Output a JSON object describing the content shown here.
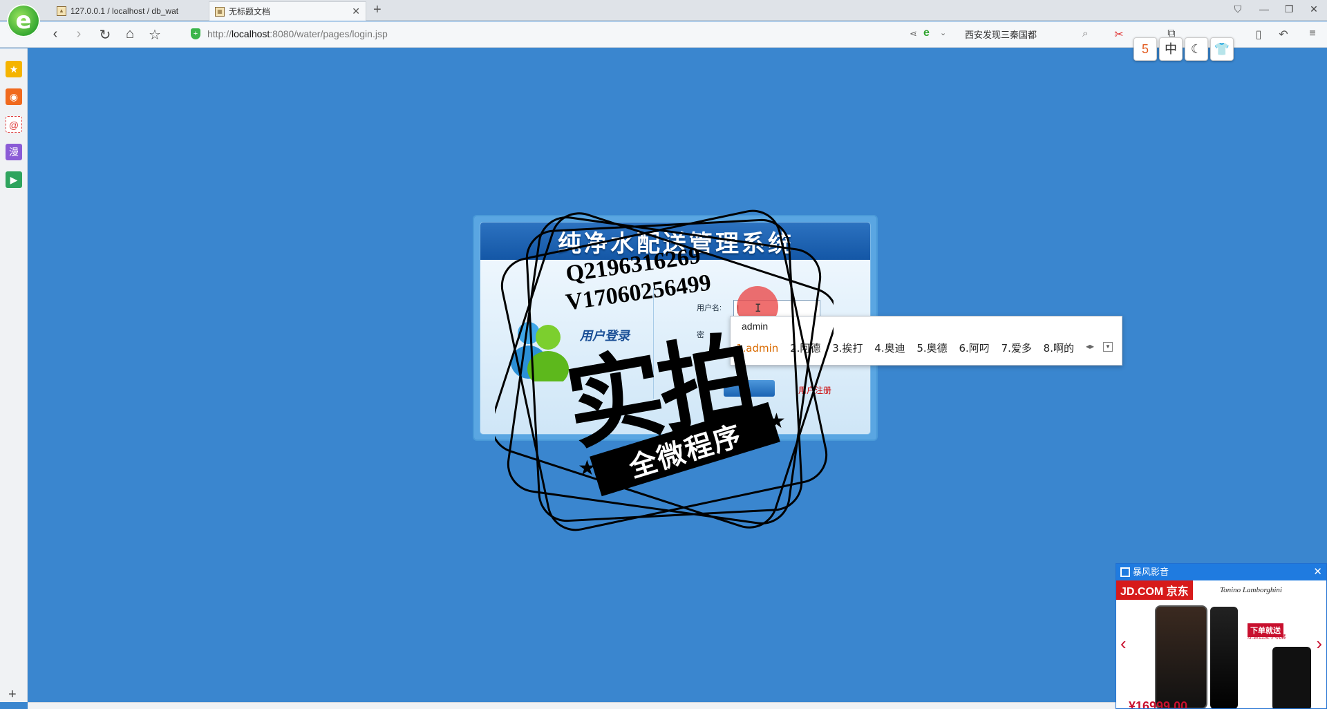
{
  "browser": {
    "tabs": [
      {
        "label": "127.0.0.1 / localhost / db_wat",
        "favicon": "PMA"
      },
      {
        "label": "无标题文档",
        "favicon": "doc"
      }
    ],
    "url_prefix": "http://",
    "url_host": "localhost",
    "url_rest": ":8080/water/pages/login.jsp",
    "search_text": "西安发现三秦国都"
  },
  "login": {
    "title": "纯净水配送管理系统",
    "caption": "用户登录",
    "username_label": "用户名:",
    "username_value": "|",
    "password_label": "密",
    "login_button": "",
    "register_link": "用户注册"
  },
  "ime": {
    "composition": "admin",
    "candidates": [
      "1.admin",
      "2.阿德",
      "3.挨打",
      "4.奥迪",
      "5.奥德",
      "6.阿叼",
      "7.爱多",
      "8.啊的"
    ]
  },
  "watermark": {
    "qq": "Q2196316269",
    "vx": "V17060256499",
    "big_text": "实拍",
    "ribbon": "全微程序"
  },
  "ad": {
    "title": "暴风影音",
    "jd_label": "JD.COM 京东",
    "brand": "Tonino Lamborghini",
    "badge": "下单就送",
    "badge_sub": "原装真皮手机套",
    "price": "¥16999.00"
  },
  "colors": {
    "page_bg": "#3a86cf",
    "login_header": "#1457a6",
    "register_link": "#cc0000",
    "ad_header": "#1f7be0"
  }
}
